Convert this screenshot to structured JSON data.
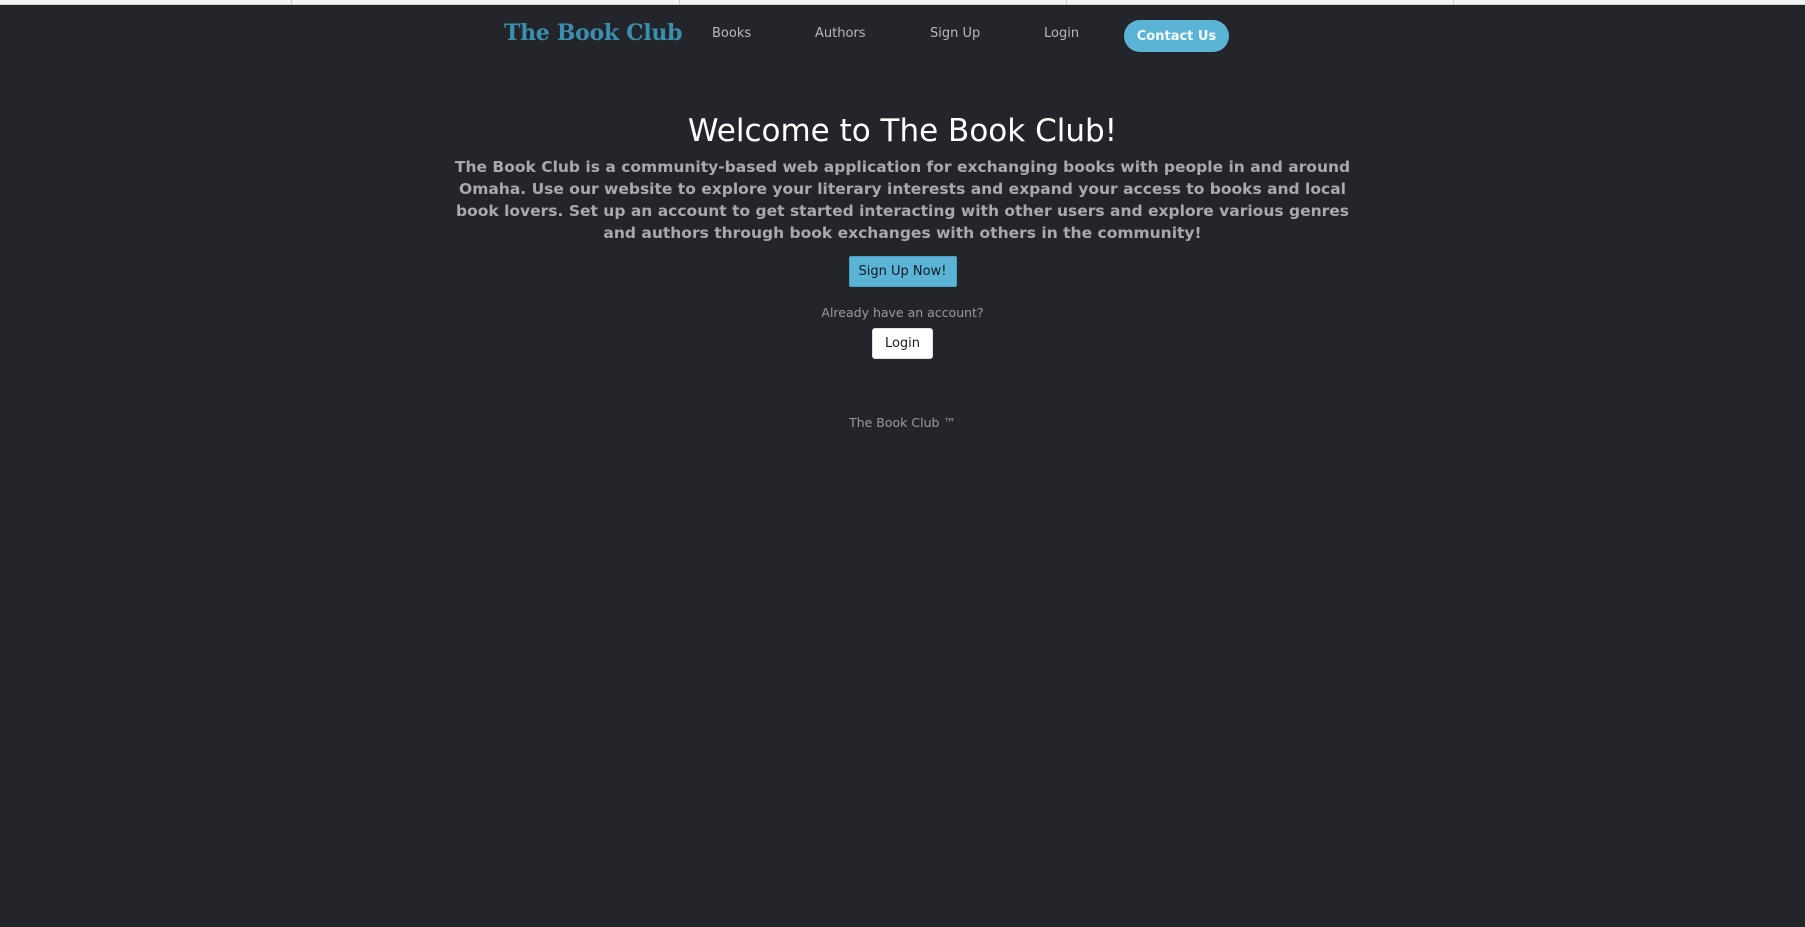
{
  "navbar": {
    "brand": "The Book Club",
    "links": [
      {
        "label": "Books"
      },
      {
        "label": "Authors"
      },
      {
        "label": "Sign Up"
      },
      {
        "label": "Login"
      }
    ],
    "contact_label": "Contact Us"
  },
  "hero": {
    "title": "Welcome to The Book Club!",
    "description": "The Book Club is a community-based web application for exchanging books with people in and around Omaha. Use our website to explore your literary interests and expand your access to books and local book lovers. Set up an account to get started interacting with other users and explore various genres and authors through book exchanges with others in the community!",
    "signup_button": "Sign Up Now!",
    "already_text": "Already have an account?",
    "login_button": "Login"
  },
  "footer": {
    "text": "The Book Club ™"
  },
  "colors": {
    "background": "#24252a",
    "accent": "#5bb4d6",
    "brand": "#3a8fb0"
  }
}
